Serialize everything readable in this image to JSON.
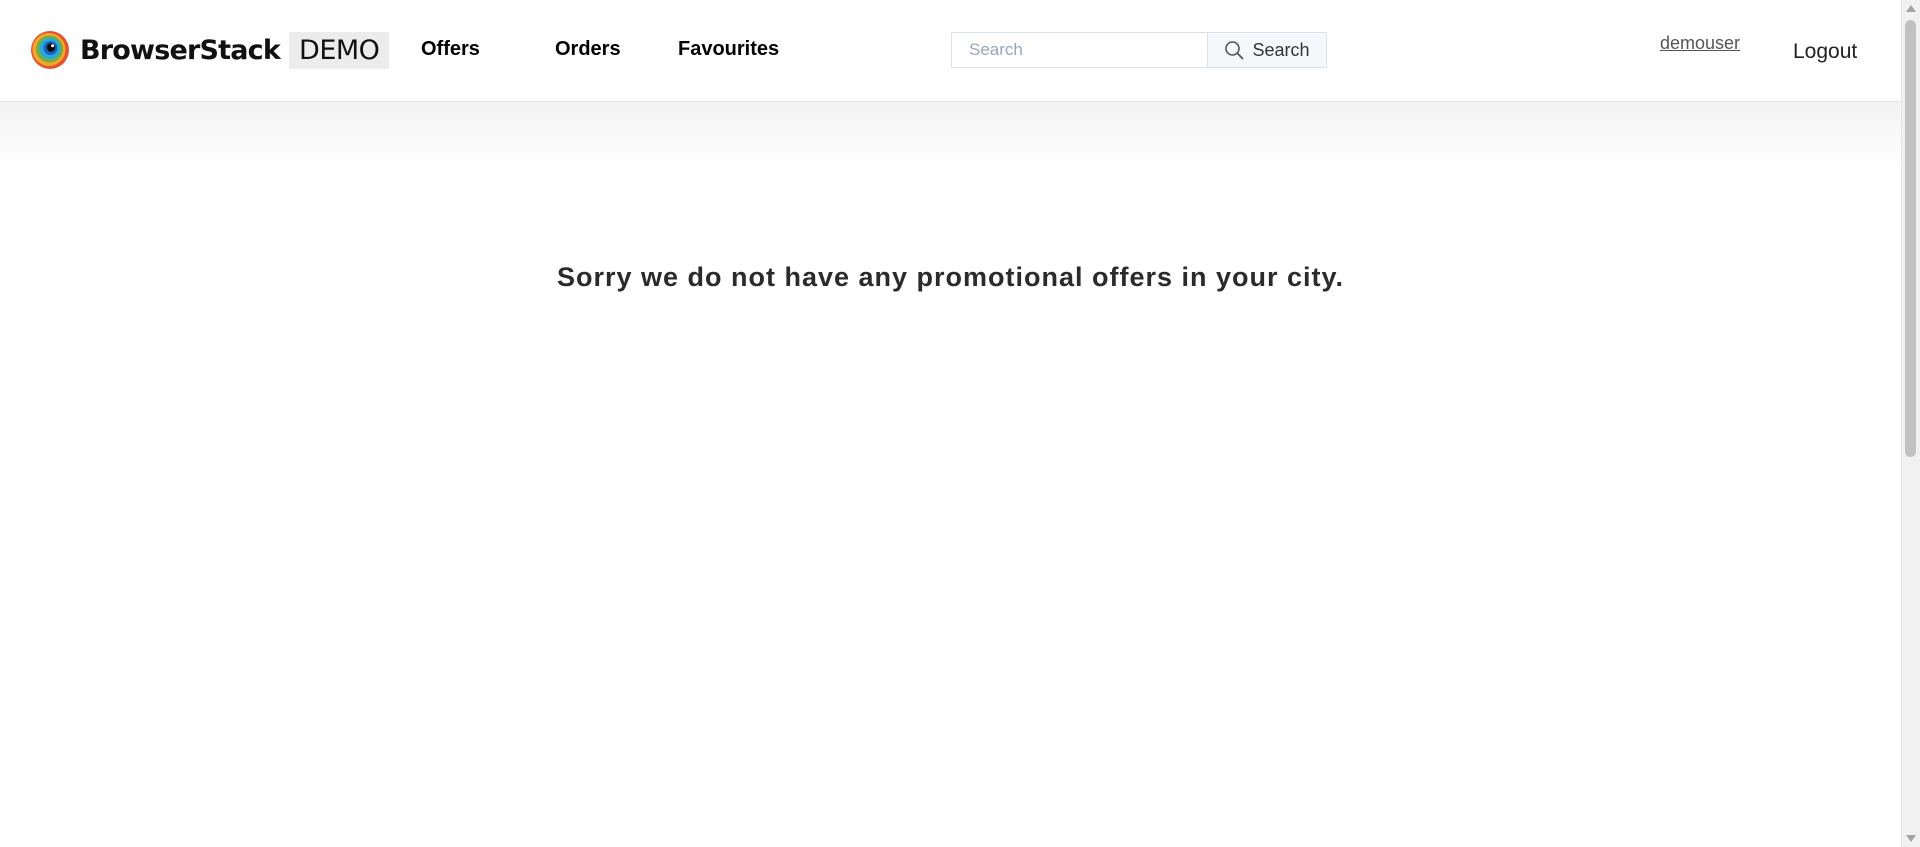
{
  "header": {
    "brand_name": "BrowserStack",
    "brand_badge": "DEMO",
    "nav": {
      "offers": "Offers",
      "orders": "Orders",
      "favourites": "Favourites"
    },
    "search": {
      "placeholder": "Search",
      "value": "",
      "button_label": "Search",
      "button_icon": "search-icon"
    },
    "username": "demouser",
    "logout_label": "Logout"
  },
  "main": {
    "message": "Sorry we do not have any promotional offers in your city."
  },
  "colors": {
    "background": "#ffffff",
    "text": "#2b2b2b",
    "badge_background": "#ececec"
  }
}
